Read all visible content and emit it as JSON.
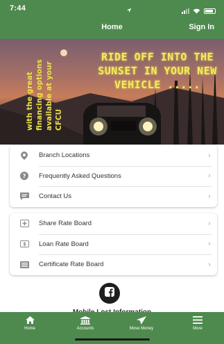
{
  "status_bar": {
    "time": "7:44"
  },
  "nav": {
    "title": "Home",
    "sign_in": "Sign In"
  },
  "hero": {
    "vertical_lines": [
      "with the great",
      "financing options",
      "available at your",
      "CFCU"
    ],
    "headline": "RIDE OFF INTO THE SUNSET IN YOUR NEW VEHICLE ....."
  },
  "menu_group_1": [
    {
      "label": "Branch Locations",
      "icon": "location-pin-icon"
    },
    {
      "label": "Frequently Asked Questions",
      "icon": "question-circle-icon"
    },
    {
      "label": "Contact Us",
      "icon": "chat-bubble-icon"
    }
  ],
  "menu_group_2": [
    {
      "label": "Share Rate Board",
      "icon": "plus-square-icon"
    },
    {
      "label": "Loan Rate Board",
      "icon": "dollar-card-icon"
    },
    {
      "label": "Certificate Rate Board",
      "icon": "list-lines-icon"
    }
  ],
  "social": {
    "icon": "facebook-icon",
    "cut_text": "Mobile Lost Information"
  },
  "tabs": [
    {
      "label": "Home",
      "icon": "home-icon"
    },
    {
      "label": "Accounts",
      "icon": "bank-icon"
    },
    {
      "label": "Move Money",
      "icon": "paper-plane-icon"
    },
    {
      "label": "More",
      "icon": "menu-icon"
    }
  ],
  "colors": {
    "brand_green": "#4e8a4e",
    "headline_yellow": "#f2ea5e"
  }
}
